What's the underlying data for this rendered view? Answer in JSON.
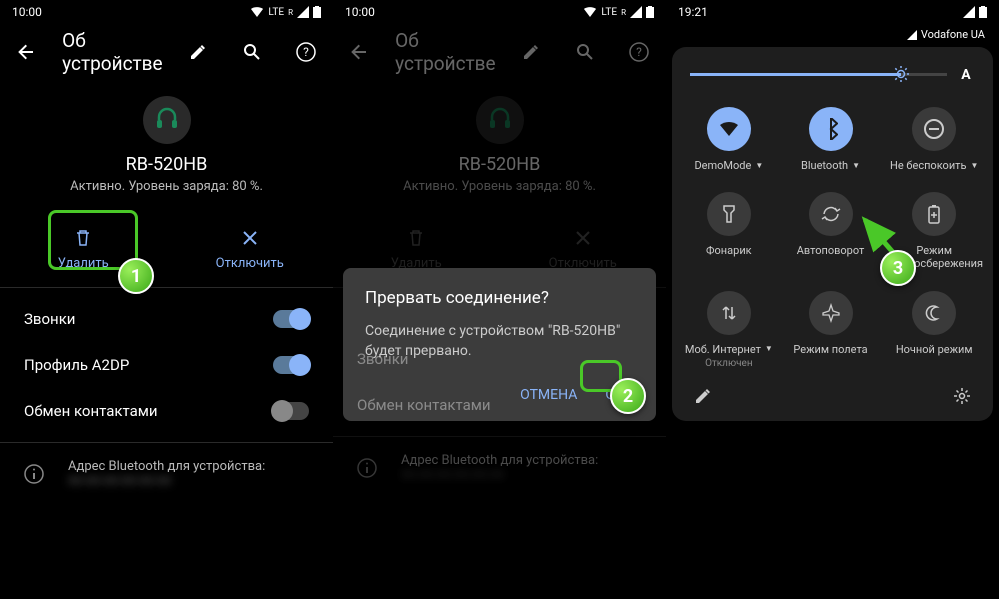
{
  "p1": {
    "time": "10:00",
    "net": "LTE",
    "title": "Об устройстве",
    "device": {
      "name": "RB-520HB",
      "status": "Активно. Уровень заряда: 80 %."
    },
    "actions": {
      "delete": "Удалить",
      "disconnect": "Отключить"
    },
    "settings": {
      "calls": "Звонки",
      "a2dp": "Профиль A2DP",
      "contacts": "Обмен контактами"
    },
    "info": "Адрес Bluetooth для устройства:"
  },
  "p2": {
    "time": "10:00",
    "net": "LTE",
    "title": "Об устройстве",
    "device": {
      "name": "RB-520HB",
      "status": "Активно. Уровень заряда: 80 %."
    },
    "actions": {
      "delete": "Удалить",
      "disconnect": "Отключить"
    },
    "settings": {
      "calls": "Звонки",
      "contacts": "Обмен контактами"
    },
    "info": "Адрес Bluetooth для устройства:",
    "dialog": {
      "title": "Прервать соединение?",
      "msg": "Соединение с устройством \"RB-520HB\" будет прервано.",
      "cancel": "Отмена",
      "ok": "ОК"
    }
  },
  "p3": {
    "time": "19:21",
    "carrier": "Vodafone UA",
    "tiles": {
      "wifi": "DemoMode",
      "bt": "Bluetooth",
      "dnd": "Не беспокоить",
      "flash": "Фонарик",
      "rotate": "Автоповорот",
      "saver": "Режим энергосбережения",
      "data": "Моб. Интернет",
      "data_sub": "Отключен",
      "airplane": "Режим полета",
      "night": "Ночной режим"
    }
  },
  "markers": {
    "m1": "1",
    "m2": "2",
    "m3": "3"
  }
}
